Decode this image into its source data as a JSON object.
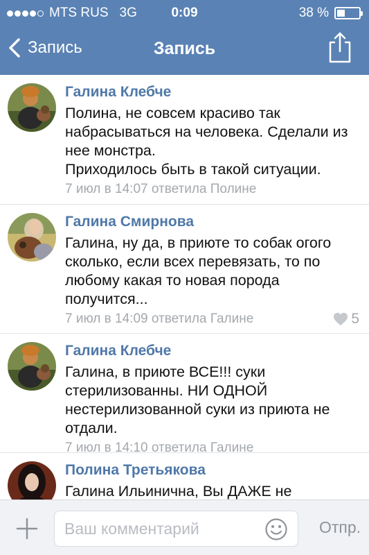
{
  "status": {
    "carrier": "MTS RUS",
    "network": "3G",
    "time": "0:09",
    "battery": "38 %",
    "battery_level": 0.38
  },
  "nav": {
    "back_label": "Запись",
    "title": "Запись"
  },
  "comments": [
    {
      "author": "Галина Клебче",
      "text": "Полина, не совсем красиво так набрасываться на человека. Сделали из нее монстра.\nПриходилось быть в такой ситуации.",
      "meta": "7 июл в 14:07 ответила Полине",
      "likes": ""
    },
    {
      "author": "Галина Смирнова",
      "text": "Галина, ну да, в приюте то собак огого сколько, если всех перевязать, то по любому какая то новая порода получится...",
      "meta": "7 июл в 14:09 ответила Галине",
      "likes": "5"
    },
    {
      "author": "Галина Клебче",
      "text": "Галина, в приюте ВСЕ!!! суки стерилизованны. НИ ОДНОЙ нестерилизованной суки из приюта не отдали.",
      "meta": "7 июл в 14:10 ответила Галине",
      "likes": ""
    },
    {
      "author": "Полина Третьякова",
      "text": "Галина Ильинична, Вы ДАЖЕ не",
      "meta": "",
      "likes": ""
    }
  ],
  "input": {
    "placeholder": "Ваш комментарий",
    "send_label": "Отпр."
  },
  "icons": {
    "back": "chevron-left-icon",
    "share": "share-icon",
    "add": "plus-icon",
    "emoji": "smiley-icon",
    "like": "heart-icon"
  },
  "colors": {
    "header": "#5a82b4",
    "author": "#4f78a8",
    "meta": "#a4a8ad"
  }
}
